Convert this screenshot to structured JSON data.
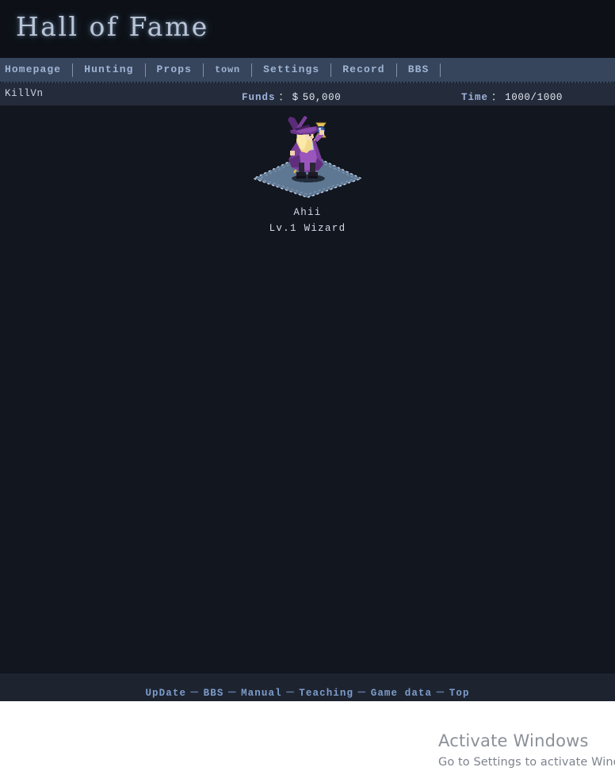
{
  "header": {
    "logo_text": "Hall of Fame"
  },
  "nav": {
    "items": [
      {
        "label": "Homepage",
        "name": "nav-homepage",
        "small": false
      },
      {
        "label": "Hunting",
        "name": "nav-hunting",
        "small": false
      },
      {
        "label": "Props",
        "name": "nav-props",
        "small": false
      },
      {
        "label": "town",
        "name": "nav-town",
        "small": true
      },
      {
        "label": "Settings",
        "name": "nav-settings",
        "small": false
      },
      {
        "label": "Record",
        "name": "nav-record",
        "small": false
      },
      {
        "label": "BBS",
        "name": "nav-bbs",
        "small": false
      }
    ]
  },
  "status": {
    "player_name": "KillVn",
    "funds_label": "Funds",
    "funds_colon": "：",
    "funds_currency": "$",
    "funds_value": "50,000",
    "time_label": "Time",
    "time_colon": "：",
    "time_value": "1000/1000"
  },
  "character": {
    "name": "Ahii",
    "class_line": "Lv.1 Wizard",
    "sprite_name": "wizard-sprite",
    "platform_name": "isometric-platform"
  },
  "watermark": {
    "title": "Activate Windows",
    "subtitle": "Go to Settings to activate Windows."
  },
  "footer": {
    "separator": "－",
    "links": [
      {
        "label": "UpDate",
        "name": "footer-update"
      },
      {
        "label": "BBS",
        "name": "footer-bbs"
      },
      {
        "label": "Manual",
        "name": "footer-manual"
      },
      {
        "label": "Teaching",
        "name": "footer-teaching"
      },
      {
        "label": "Game data",
        "name": "footer-game-data"
      },
      {
        "label": "Top",
        "name": "footer-top"
      }
    ]
  },
  "colors": {
    "page_bg": "#181d27",
    "header_bg": "#0d1117",
    "navbar_bg": "#36455c",
    "statusbar_bg": "#242b3a",
    "stage_bg": "#12161f",
    "footer_bg": "#1d2430",
    "nav_link": "#9fb4d4",
    "footer_link": "#7e9ccb",
    "logo": "#b9c6d8",
    "platform": "#5e7792",
    "robe_purple": "#8a4fa8",
    "hair_blonde": "#f2d98a"
  }
}
